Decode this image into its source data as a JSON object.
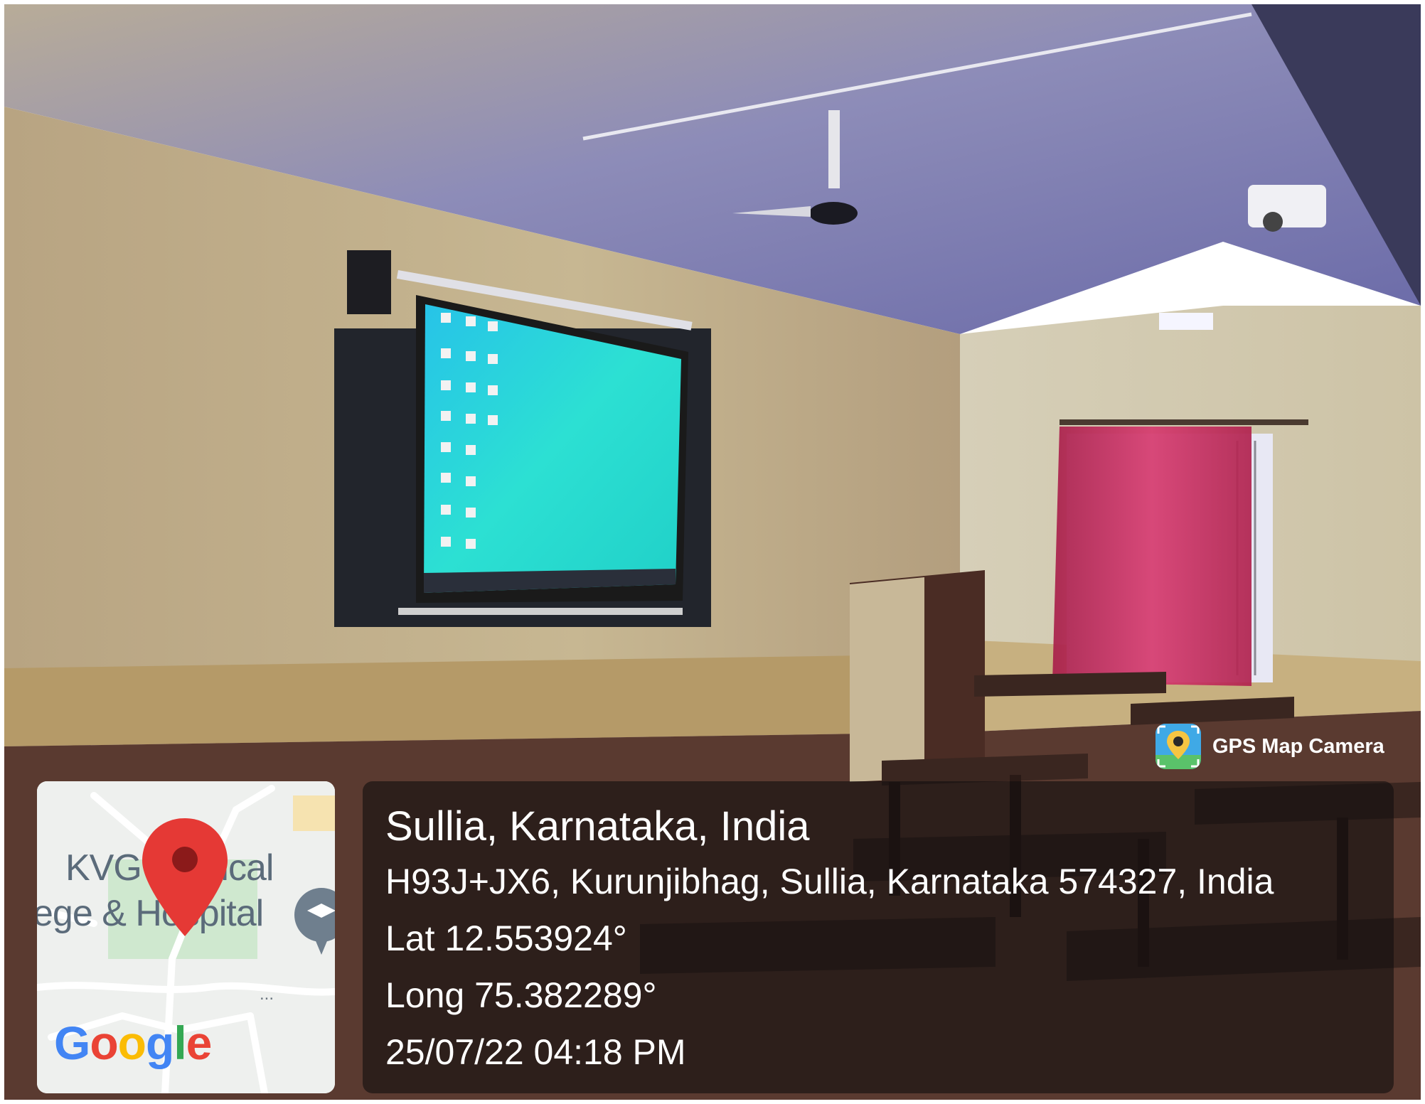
{
  "photo": {
    "scene": "classroom",
    "colors": {
      "wall": "#c4b08c",
      "ceiling": "#8a8ab8",
      "screen": "#2cd6d0",
      "curtain": "#c8285a",
      "floor": "#5a3a30"
    }
  },
  "map": {
    "label_line1": "KVG Medical",
    "label_line2": "ege & Hospital",
    "brand": "Google",
    "more_glyph": "...",
    "pin_color": "#e53935",
    "icons": [
      "map-pin-icon",
      "school-icon"
    ]
  },
  "info": {
    "title": "Sullia, Karnataka, India",
    "address": "H93J+JX6, Kurunjibhag, Sullia, Karnataka 574327, India",
    "latitude": "Lat 12.553924°",
    "longitude": "Long 75.382289°",
    "datetime": "25/07/22 04:18 PM"
  },
  "watermark": {
    "app_name": "GPS Map Camera",
    "icon": "gps-map-camera-icon"
  }
}
